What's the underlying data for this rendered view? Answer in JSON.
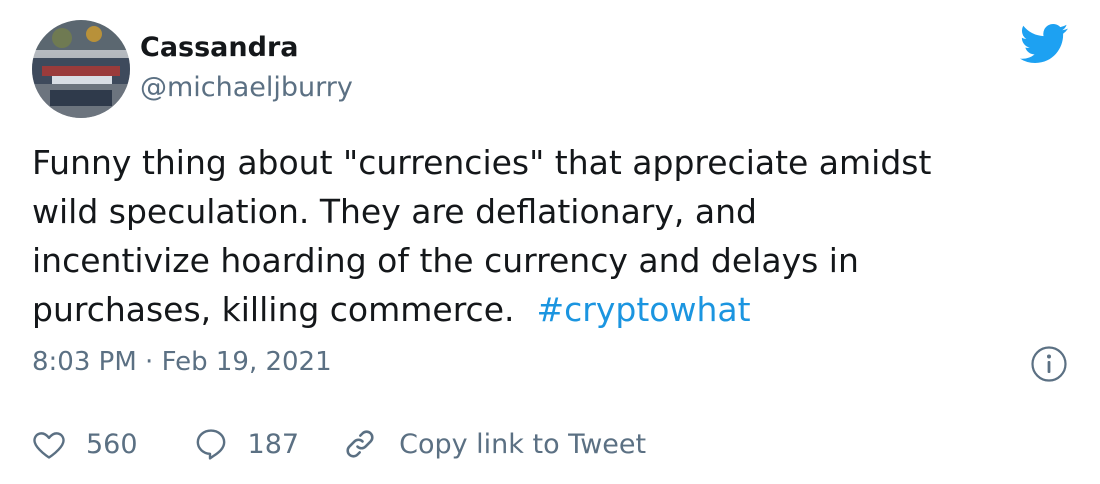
{
  "tweet": {
    "author_name": "Cassandra",
    "author_handle": "@michaeljburry",
    "text_lines": [
      "Funny thing about \"currencies\" that appreciate amidst",
      "wild speculation. They are deflationary, and",
      "incentivize hoarding of the currency and delays in",
      "purchases, killing commerce."
    ],
    "hashtag": "#cryptowhat",
    "time": "8:03 PM",
    "separator": "·",
    "date": "Feb 19, 2021"
  },
  "actions": {
    "like_count": "560",
    "reply_count": "187",
    "copy_link_label": "Copy link to Tweet"
  },
  "icons": {
    "brand": "twitter-bird-icon",
    "info": "info-icon",
    "like": "heart-icon",
    "reply": "reply-bubble-icon",
    "copy": "link-icon"
  },
  "colors": {
    "brand_blue": "#1da1f2",
    "hashtag_blue": "#1b95e0",
    "text_primary": "#14171a",
    "text_secondary": "#5b7083"
  }
}
